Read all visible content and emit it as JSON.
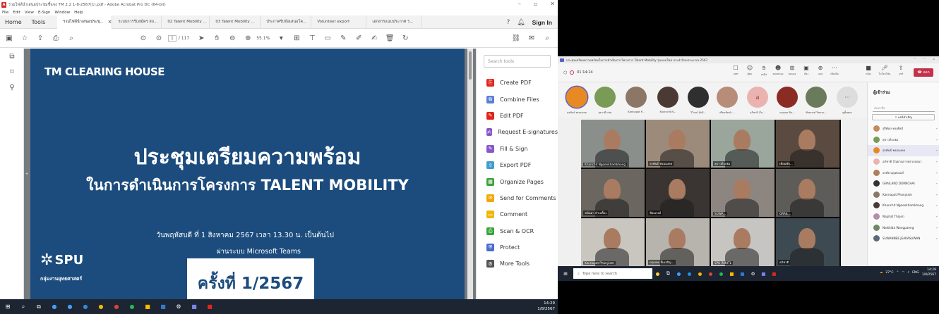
{
  "acrobat": {
    "title": "รวมไฟล์นำเสนอประชุมชี้แจง TM 2.2 1-8-2567(1).pdf - Adobe Acrobat Pro DC (64-bit)",
    "menu": [
      "File",
      "Edit",
      "View",
      "E-Sign",
      "Window",
      "Help"
    ],
    "tab_home": "Home",
    "tab_tools": "Tools",
    "doc_tabs": [
      "รวมไฟล์นำเสนอประชุ...",
      "ระบบการรับสมัคร สถ...",
      "02 Talent Mobility ...",
      "03 Talent Mobility ...",
      "ประกาศรับข้อเสนอโค...",
      "Volunteer export",
      "เอกสารแนบประกาศ ร..."
    ],
    "active_tab_close": "×",
    "sign_in": "Sign In",
    "page_current": "1",
    "page_total": "/ 117",
    "zoom": "55.1%",
    "search_placeholder": "Search tools",
    "tools": [
      {
        "label": "Create PDF",
        "color": "#e1251b",
        "icon": "create-pdf-icon"
      },
      {
        "label": "Combine Files",
        "color": "#5b7fd6",
        "icon": "combine-files-icon"
      },
      {
        "label": "Edit PDF",
        "color": "#e1251b",
        "icon": "edit-pdf-icon"
      },
      {
        "label": "Request E-signatures",
        "color": "#8757c9",
        "icon": "request-esign-icon"
      },
      {
        "label": "Fill & Sign",
        "color": "#8757c9",
        "icon": "fill-sign-icon"
      },
      {
        "label": "Export PDF",
        "color": "#3f9ecf",
        "icon": "export-pdf-icon"
      },
      {
        "label": "Organize Pages",
        "color": "#3aa33a",
        "icon": "organize-pages-icon"
      },
      {
        "label": "Send for Comments",
        "color": "#f0a800",
        "icon": "send-comments-icon"
      },
      {
        "label": "Comment",
        "color": "#f0b800",
        "icon": "comment-icon"
      },
      {
        "label": "Scan & OCR",
        "color": "#3aa33a",
        "icon": "scan-ocr-icon"
      },
      {
        "label": "Protect",
        "color": "#4b6bd0",
        "icon": "protect-icon"
      },
      {
        "label": "More Tools",
        "color": "#555555",
        "icon": "more-tools-icon"
      }
    ],
    "slide": {
      "brand": "TM CLEARING HOUSE",
      "heading1": "ประชุมเตรียมความพร้อม",
      "heading2": "ในการดำเนินการโครงการ TALENT MOBILITY",
      "date_line": "วันพฤหัสบดี ที่ 1 สิงหาคม 2567 เวลา 13.30 น. เป็นต้นไป",
      "via_line": "ผ่านระบบ Microsoft Teams",
      "logo_text": "SPU",
      "logo_sub": "กลุ่มงานยุทธศาสตร์",
      "session": "ครั้งที่ 1/2567",
      "bg_color": "#1c4c7d"
    },
    "clock_time": "14:29",
    "clock_date": "1/8/2567"
  },
  "teams": {
    "title": "ประชุมเตรียมความพร้อมในการดำเนินการโครงการ Talent Mobility รุ่นแบบใหม่ ประจำปีงบประมาณ 2567",
    "timer": "01:14:24",
    "actions": [
      "แชท",
      "ผู้คน",
      "ยกมือ",
      "ตอบสนอง",
      "มุมมอง",
      "ห้อง",
      "แอป",
      "เพิ่มเติม"
    ],
    "media_labels": [
      "กล้อง",
      "ไมโครโฟน",
      "แชร์"
    ],
    "leave": "ออก",
    "avatars": [
      {
        "name": "สุรพันธ์ พรมมงคล",
        "color": "#e88a24"
      },
      {
        "name": "สุธาวดี แช่ม",
        "color": "#7a9b55"
      },
      {
        "name": "Kannapat P...",
        "color": "#8c7766"
      },
      {
        "name": "Khanchit N...",
        "color": "#4b3a33"
      },
      {
        "name": "วิโรจน์ มั่นจิ...",
        "color": "#2f2f2f"
      },
      {
        "name": "เทียนชัยณ์ เ...",
        "color": "#b78d7a"
      },
      {
        "name": "อภิชาติ (โม...",
        "color": "#e9b4b0"
      },
      {
        "name": "ดรุณลด ลิม...",
        "color": "#8a2b24"
      },
      {
        "name": "ชัยณรงค์ วิทยาน...",
        "color": "#6b7a5b"
      },
      {
        "name": "ดูทั้งหมด",
        "color": "#dddddd"
      }
    ],
    "avatar_initial": "อ",
    "avatar_more": "···",
    "tiles": [
      {
        "name": "Khanchit Ngoenkhamkhong",
        "color": "#8a8f8c"
      },
      {
        "name": "สุรพันธ์ พรมมงคล",
        "color": "#9c8a7a"
      },
      {
        "name": "สุธาวดี แช่ม",
        "color": "#9aa69c"
      },
      {
        "name": "เทียนชัย...",
        "color": "#5a4a3f"
      },
      {
        "name": "ชนันดา ทำเปลื้อง",
        "color": "#6b6760"
      },
      {
        "name": "ชัยณรงค์",
        "color": "#3a3532"
      },
      {
        "name": "SUWA...",
        "color": "#8d857f"
      },
      {
        "name": "GRAIL...",
        "color": "#5d5c58"
      },
      {
        "name": "Kannapat Phonyiam",
        "color": "#c9c6c0"
      },
      {
        "name": "ดรุณลด ลิ้มเจริญ...",
        "color": "#b7b3ad"
      },
      {
        "name": "SPU RMUTL",
        "color": "#c7c5c2"
      },
      {
        "name": "อภิชาติ",
        "color": "#3e4a52"
      }
    ],
    "panel_title": "ผู้เข้าร่วม",
    "panel_search": "ค้นหาชื่อ",
    "panel_share": "แชร์คำเชิญ",
    "participants": [
      {
        "name": "สุรีพัลภ ทรงศิลป์",
        "color": "#c58b5a"
      },
      {
        "name": "สุธาวดี แช่ม",
        "color": "#7a9b55"
      },
      {
        "name": "สุรพันธ์ พรมมงคล",
        "color": "#e88a24"
      },
      {
        "name": "อภิชาติ (ไม่ผ่านการตรวจสอบ)",
        "color": "#e9b4b0"
      },
      {
        "name": "อรทัย บุญทองแก้",
        "color": "#b0805a"
      },
      {
        "name": "GRAILARD DORNCHAI",
        "color": "#333333"
      },
      {
        "name": "Kannapat Phonyiam",
        "color": "#8c7766"
      },
      {
        "name": "Khanchit Ngoenkhamkhong",
        "color": "#4b3a33"
      },
      {
        "name": "Naphat Thipsri",
        "color": "#b58ea5"
      },
      {
        "name": "Natthida Wongpaeng",
        "color": "#6d8a5f"
      },
      {
        "name": "SUWANNEE JEARASUWAN",
        "color": "#5a6a78"
      }
    ],
    "taskbar_search": "Type here to search",
    "temperature": "27°C",
    "lang": "ENG",
    "clock_time": "14:29",
    "clock_date": "1/8/2567"
  }
}
